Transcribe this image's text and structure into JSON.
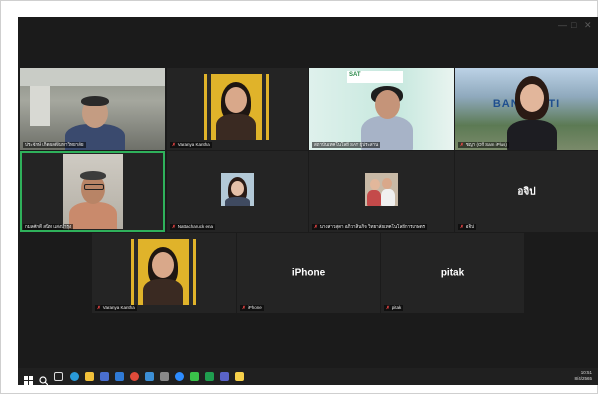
{
  "window_controls": [
    "—",
    "□",
    "✕"
  ],
  "participants": [
    {
      "id": "p1",
      "name": "ประจักษ์ เกิดผลดี/มหาวิทยาลัย",
      "muted": false
    },
    {
      "id": "p2",
      "name": "Varanya Kantha",
      "muted": true
    },
    {
      "id": "p3",
      "name": "สถาบันเทคโนโลยี SAT ผู้ประสาน",
      "muted": false
    },
    {
      "id": "p4",
      "name": "ชญา (Off Sam iPlus)",
      "muted": true,
      "bg_text": "BANGMUTI"
    },
    {
      "id": "p5",
      "name": "กมลศักดิ์ สนิท แสงบำรุง",
      "muted": false,
      "active": true
    },
    {
      "id": "p6",
      "name": "Nattacharuck ena",
      "muted": true
    },
    {
      "id": "p7",
      "name": "นางสาวสุดา อภิวาสินกิจ วิทยาลัยเทคโนโลยีการเกษตร",
      "muted": true
    },
    {
      "id": "p8",
      "name": "อจิป",
      "muted": true,
      "display": "อจิป"
    },
    {
      "id": "p9",
      "name": "Varanya Kantha",
      "muted": true
    },
    {
      "id": "p10",
      "name": "iPhone",
      "muted": true,
      "display": "iPhone"
    },
    {
      "id": "p11",
      "name": "pitak",
      "muted": true,
      "display": "pitak"
    }
  ],
  "taskbar": {
    "icons": [
      "windows-start",
      "search",
      "task-view",
      "edge",
      "file-explorer",
      "store",
      "mail",
      "chrome",
      "photos",
      "settings",
      "zoom",
      "line",
      "excel-green",
      "teams",
      "notes"
    ],
    "time": "10:51",
    "date": "8/4/2565"
  },
  "colors": {
    "active_speaker": "#2fb15b",
    "muted_mic": "#ff4a4a",
    "meeting_bg": "#1b1b1b",
    "taskbar": "#202020"
  }
}
